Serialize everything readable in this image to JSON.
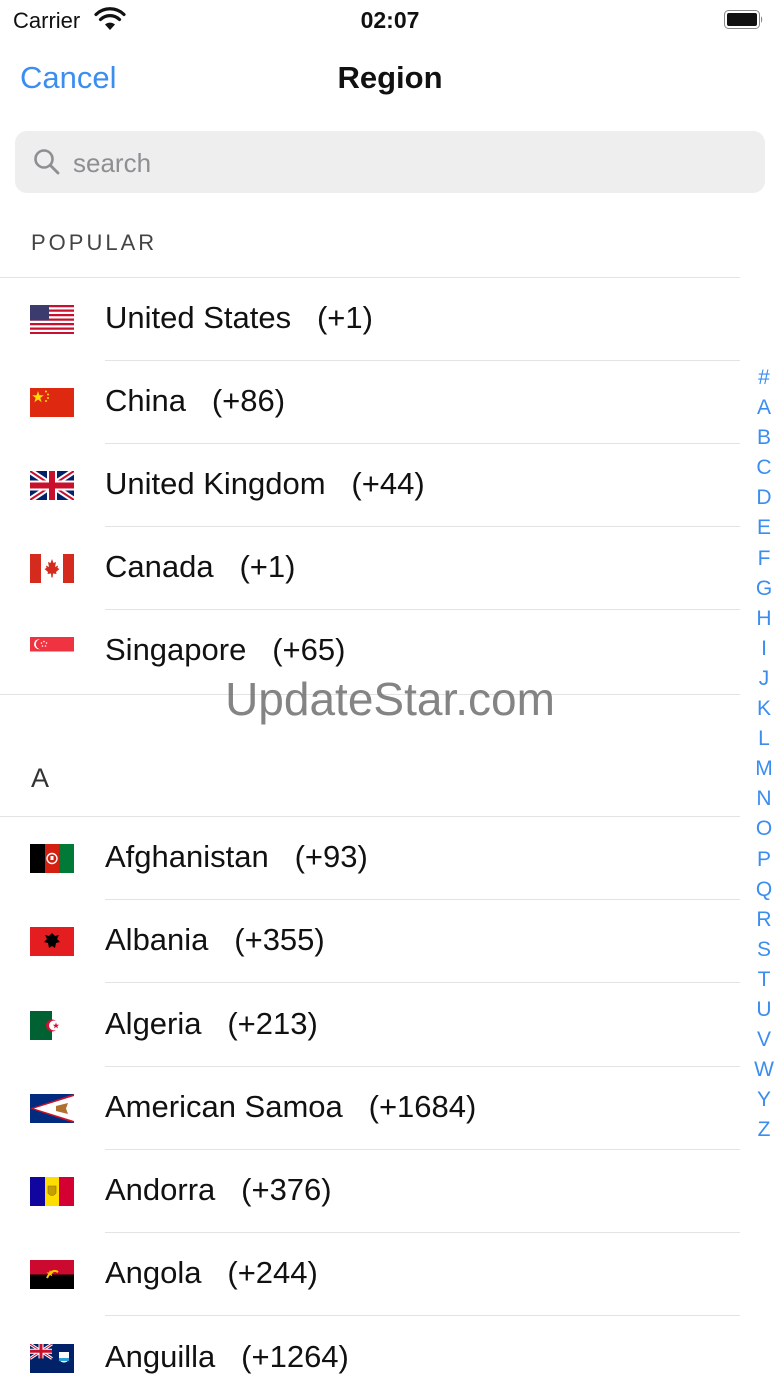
{
  "status_bar": {
    "carrier": "Carrier",
    "time": "02:07"
  },
  "nav": {
    "cancel_label": "Cancel",
    "title": "Region"
  },
  "search": {
    "placeholder": "search"
  },
  "popular": {
    "header": "POPULAR",
    "items": [
      {
        "name": "United States",
        "code": "(+1)",
        "flag_icon": "us-flag-icon"
      },
      {
        "name": "China",
        "code": "(+86)",
        "flag_icon": "cn-flag-icon"
      },
      {
        "name": "United Kingdom",
        "code": "(+44)",
        "flag_icon": "gb-flag-icon"
      },
      {
        "name": "Canada",
        "code": "(+1)",
        "flag_icon": "ca-flag-icon"
      },
      {
        "name": "Singapore",
        "code": "(+65)",
        "flag_icon": "sg-flag-icon"
      }
    ]
  },
  "section_a": {
    "header": "A",
    "items": [
      {
        "name": "Afghanistan",
        "code": "(+93)",
        "flag_icon": "af-flag-icon"
      },
      {
        "name": "Albania",
        "code": "(+355)",
        "flag_icon": "al-flag-icon"
      },
      {
        "name": "Algeria",
        "code": "(+213)",
        "flag_icon": "dz-flag-icon"
      },
      {
        "name": "American Samoa",
        "code": "(+1684)",
        "flag_icon": "as-flag-icon"
      },
      {
        "name": "Andorra",
        "code": "(+376)",
        "flag_icon": "ad-flag-icon"
      },
      {
        "name": "Angola",
        "code": "(+244)",
        "flag_icon": "ao-flag-icon"
      },
      {
        "name": "Anguilla",
        "code": "(+1264)",
        "flag_icon": "ai-flag-icon"
      }
    ]
  },
  "index_letters": [
    "#",
    "A",
    "B",
    "C",
    "D",
    "E",
    "F",
    "G",
    "H",
    "I",
    "J",
    "K",
    "L",
    "M",
    "N",
    "O",
    "P",
    "Q",
    "R",
    "S",
    "T",
    "U",
    "V",
    "W",
    "Y",
    "Z"
  ],
  "watermark": "UpdateStar.com",
  "colors": {
    "accent": "#3b8ef0",
    "search_bg": "#eeeeef",
    "separator": "#e3e3e6"
  }
}
